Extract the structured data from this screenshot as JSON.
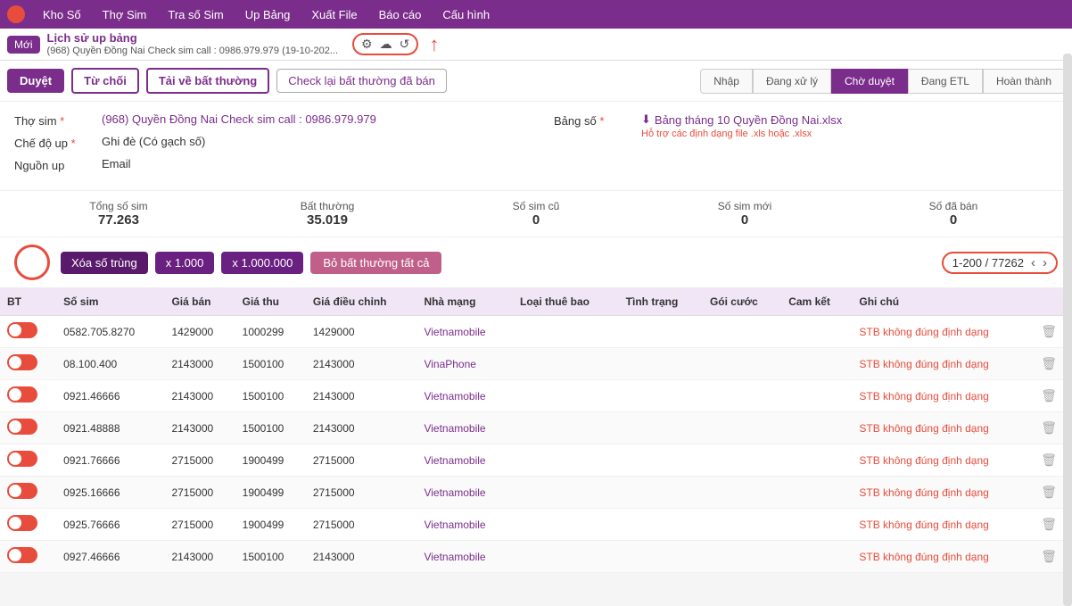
{
  "topnav": {
    "logo": "●",
    "items": [
      "Kho Số",
      "Thợ Sim",
      "Tra số Sim",
      "Up Bảng",
      "Xuất File",
      "Báo cáo",
      "Cấu hình"
    ]
  },
  "tabbar": {
    "new_label": "Mới",
    "tab_title": "Lịch sử up bảng",
    "tab_subtitle": "(968) Quyền Đồng Nai Check sim call : 0986.979.979 (19-10-202...",
    "icons": [
      "⚙",
      "☁",
      "↺"
    ]
  },
  "actions": {
    "duyet": "Duyệt",
    "tu_choi": "Từ chối",
    "tai_ve": "Tải về bất thường",
    "check_lai": "Check lại bất thường đã bán"
  },
  "status_tabs": {
    "items": [
      "Nhập",
      "Đang xử lý",
      "Chờ duyệt",
      "Đang ETL",
      "Hoàn thành"
    ],
    "active": "Chờ duyệt"
  },
  "form": {
    "tho_sim_label": "Thợ sim",
    "tho_sim_value": "(968) Quyền Đồng Nai Check sim call : 0986.979.979",
    "che_do_label": "Chế độ up",
    "che_do_value": "Ghi đè (Có gạch số)",
    "nguon_label": "Nguồn up",
    "nguon_value": "Email",
    "bang_so_label": "Bảng số",
    "bang_so_link": "Bảng tháng 10 Quyền Đồng Nai.xlsx",
    "bang_so_sub": "Hỗ trợ các định dạng file .xls hoặc .xlsx"
  },
  "stats": {
    "items": [
      {
        "label": "Tổng số sim",
        "value": "77.263"
      },
      {
        "label": "Bất thường",
        "value": "35.019"
      },
      {
        "label": "Số sim cũ",
        "value": "0"
      },
      {
        "label": "Số sim mới",
        "value": "0"
      },
      {
        "label": "Số đã bán",
        "value": "0"
      }
    ]
  },
  "table_controls": {
    "xoa_so": "Xóa số trùng",
    "x1000": "x 1.000",
    "x1000000": "x 1.000.000",
    "bo_bat_thuong": "Bỏ bất thường tất cả",
    "pagination_text": "1-200 / 77262",
    "prev": "‹",
    "next": "›"
  },
  "table": {
    "headers": [
      "BT",
      "Số sim",
      "Giá bán",
      "Giá thu",
      "Giá điều chỉnh",
      "Nhà mạng",
      "Loại thuê bao",
      "Tình trạng",
      "Gói cước",
      "Cam kết",
      "Ghi chú",
      "",
      ""
    ],
    "rows": [
      {
        "bt": true,
        "so_sim": "0582.705.8270",
        "gia_ban": "1429000",
        "gia_thu": "1000299",
        "gia_dc": "1429000",
        "nha_mang": "Vietnamobile",
        "loai_tb": "",
        "tinh_trang": "",
        "goi_cuoc": "",
        "cam_ket": "",
        "ghi_chu": "STB không đúng định dạng"
      },
      {
        "bt": true,
        "so_sim": "08.100.400",
        "gia_ban": "2143000",
        "gia_thu": "1500100",
        "gia_dc": "2143000",
        "nha_mang": "VinaPhone",
        "loai_tb": "",
        "tinh_trang": "",
        "goi_cuoc": "",
        "cam_ket": "",
        "ghi_chu": "STB không đúng định dạng"
      },
      {
        "bt": true,
        "so_sim": "0921.46666",
        "gia_ban": "2143000",
        "gia_thu": "1500100",
        "gia_dc": "2143000",
        "nha_mang": "Vietnamobile",
        "loai_tb": "",
        "tinh_trang": "",
        "goi_cuoc": "",
        "cam_ket": "",
        "ghi_chu": "STB không đúng định dạng"
      },
      {
        "bt": true,
        "so_sim": "0921.48888",
        "gia_ban": "2143000",
        "gia_thu": "1500100",
        "gia_dc": "2143000",
        "nha_mang": "Vietnamobile",
        "loai_tb": "",
        "tinh_trang": "",
        "goi_cuoc": "",
        "cam_ket": "",
        "ghi_chu": "STB không đúng định dạng"
      },
      {
        "bt": true,
        "so_sim": "0921.76666",
        "gia_ban": "2715000",
        "gia_thu": "1900499",
        "gia_dc": "2715000",
        "nha_mang": "Vietnamobile",
        "loai_tb": "",
        "tinh_trang": "",
        "goi_cuoc": "",
        "cam_ket": "",
        "ghi_chu": "STB không đúng định dạng"
      },
      {
        "bt": true,
        "so_sim": "0925.16666",
        "gia_ban": "2715000",
        "gia_thu": "1900499",
        "gia_dc": "2715000",
        "nha_mang": "Vietnamobile",
        "loai_tb": "",
        "tinh_trang": "",
        "goi_cuoc": "",
        "cam_ket": "",
        "ghi_chu": "STB không đúng định dạng"
      },
      {
        "bt": true,
        "so_sim": "0925.76666",
        "gia_ban": "2715000",
        "gia_thu": "1900499",
        "gia_dc": "2715000",
        "nha_mang": "Vietnamobile",
        "loai_tb": "",
        "tinh_trang": "",
        "goi_cuoc": "",
        "cam_ket": "",
        "ghi_chu": "STB không đúng định dạng"
      },
      {
        "bt": true,
        "so_sim": "0927.46666",
        "gia_ban": "2143000",
        "gia_thu": "1500100",
        "gia_dc": "2143000",
        "nha_mang": "Vietnamobile",
        "loai_tb": "",
        "tinh_trang": "",
        "goi_cuoc": "",
        "cam_ket": "",
        "ghi_chu": "STB không đúng định dạng"
      }
    ]
  },
  "colors": {
    "purple": "#7b2d8b",
    "red": "#e74c3c",
    "light_purple_bg": "#f0e6f6"
  }
}
